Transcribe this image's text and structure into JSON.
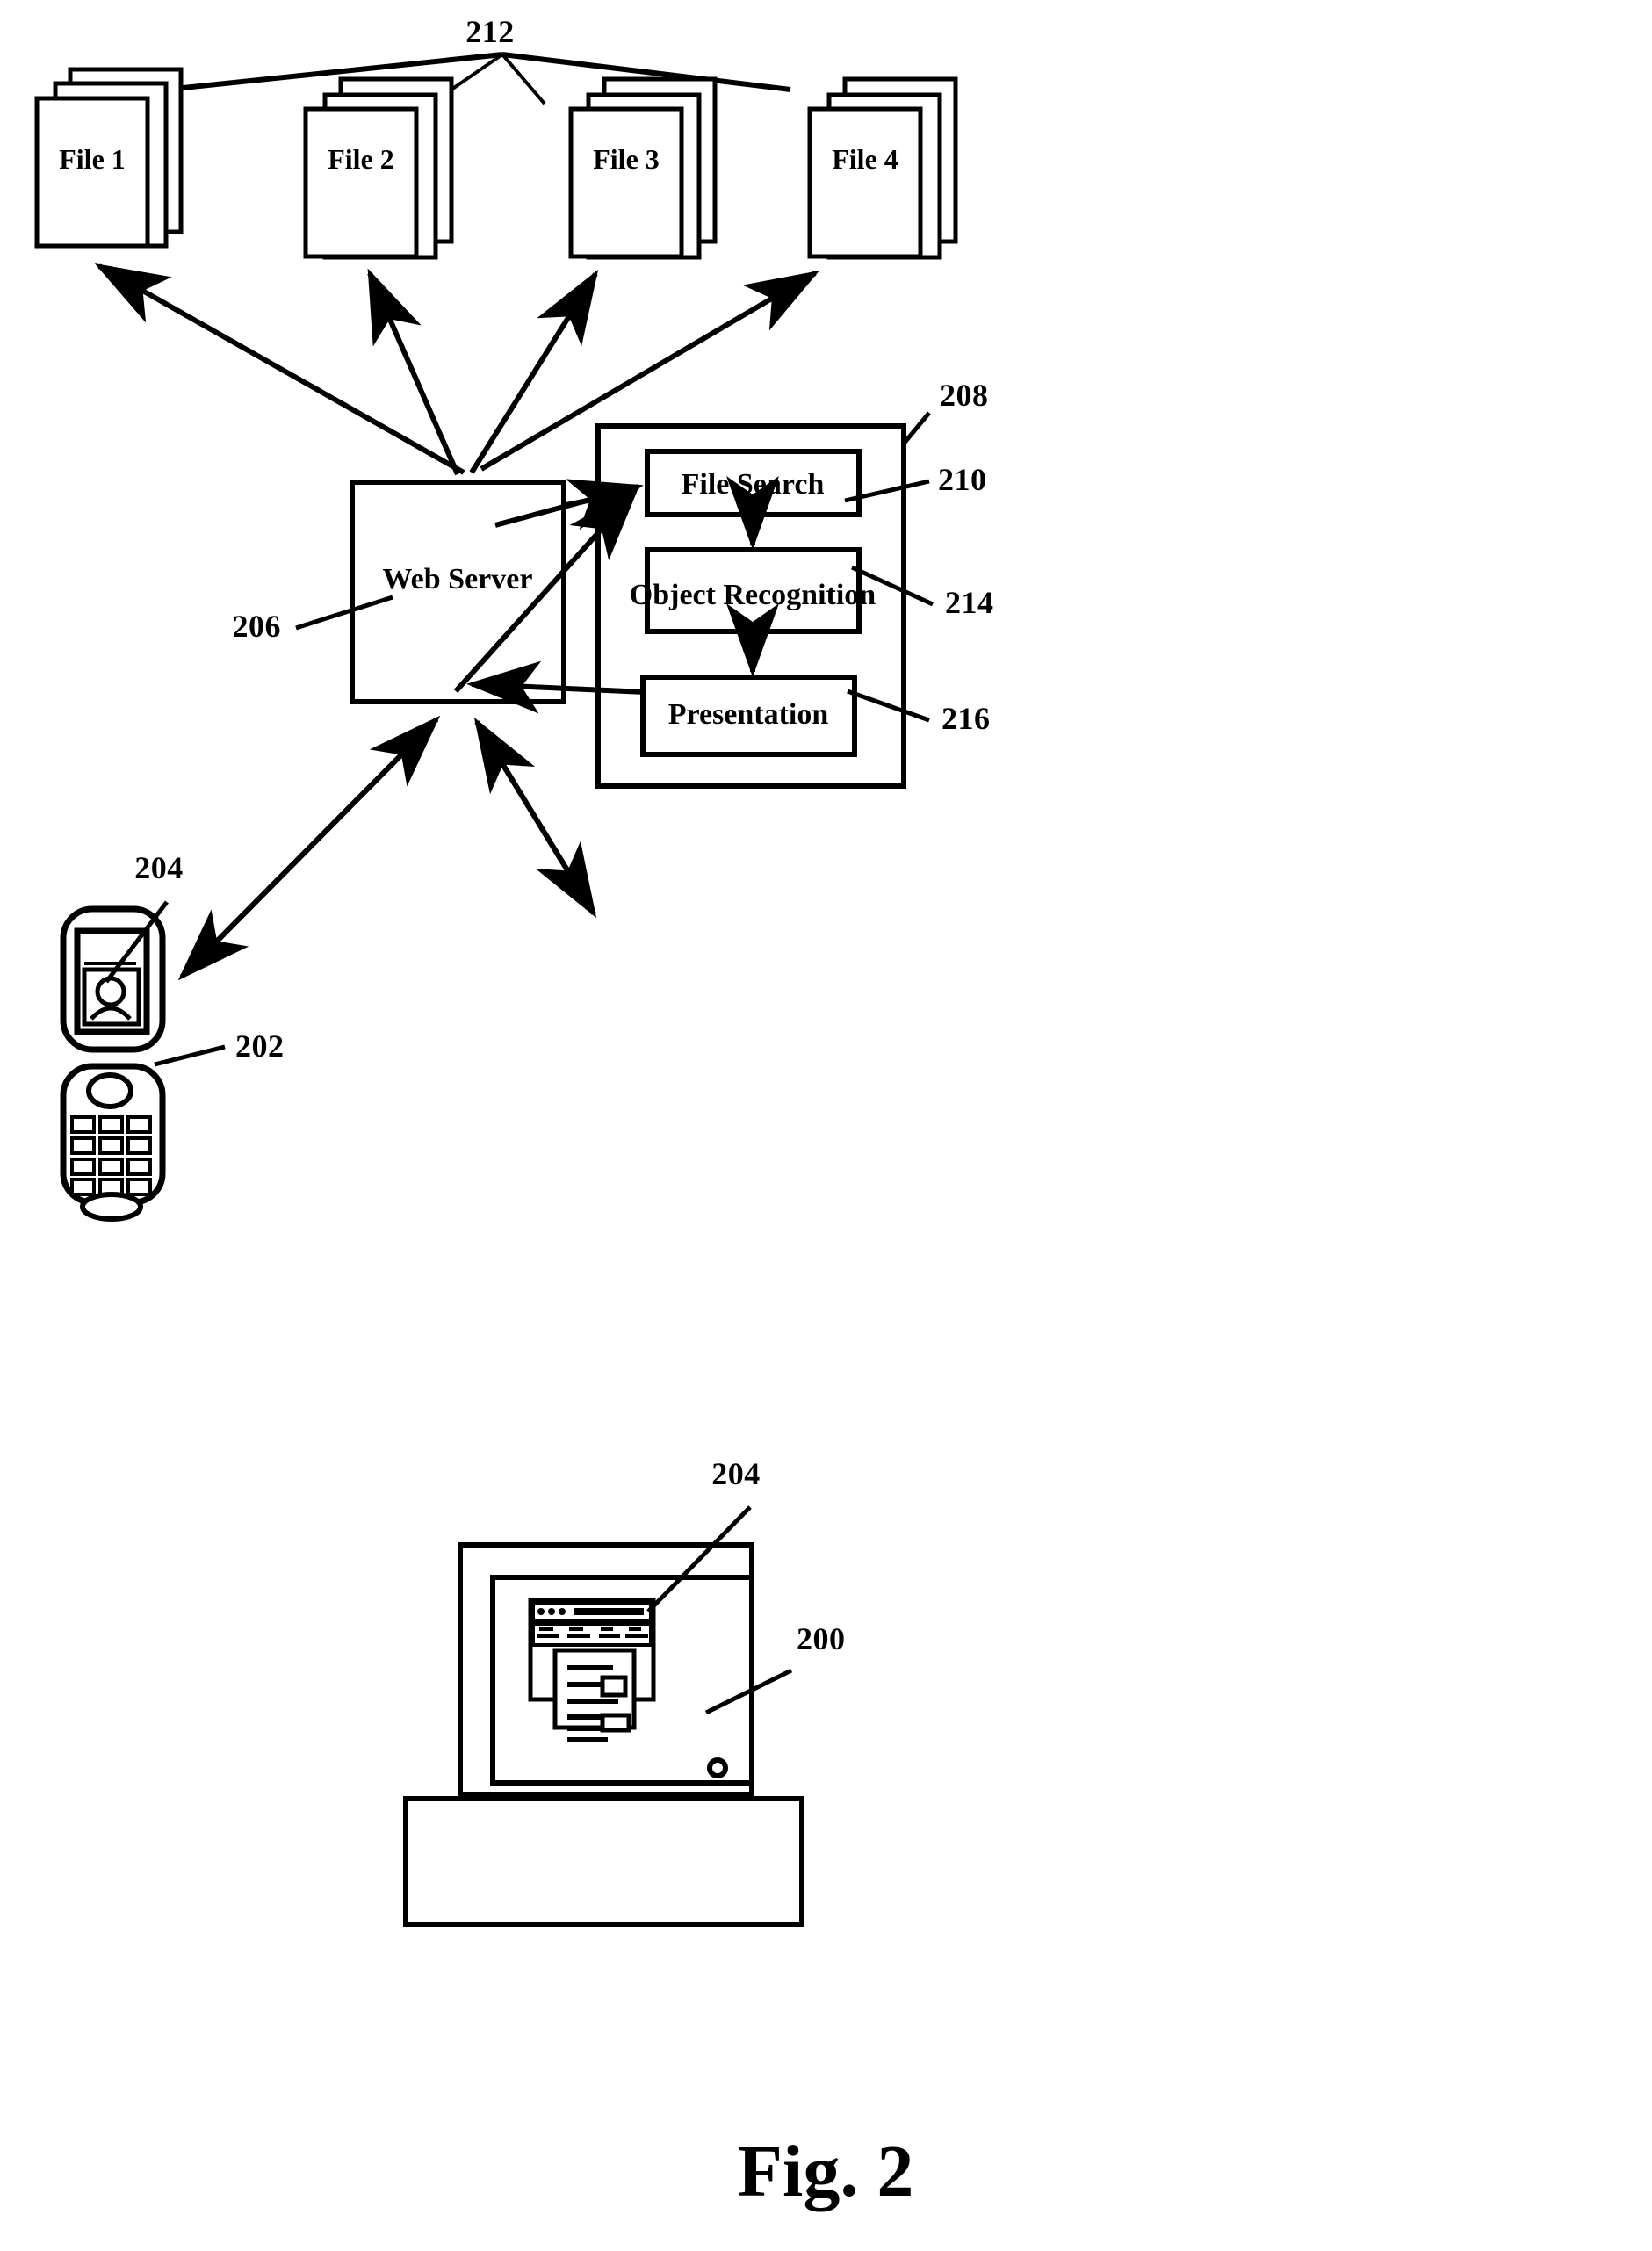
{
  "figure": {
    "caption": "Fig. 2",
    "files": [
      {
        "label": "File 1"
      },
      {
        "label": "File 2"
      },
      {
        "label": "File 3"
      },
      {
        "label": "File 4"
      }
    ],
    "server": {
      "label": "Web Server",
      "ref": "206"
    },
    "processing_container": {
      "ref": "208",
      "modules": [
        {
          "label": "File Search",
          "ref": "210"
        },
        {
          "label": "Object Recognition",
          "ref": "214"
        },
        {
          "label": "Presentation",
          "ref": "216"
        }
      ]
    },
    "reference_numerals": {
      "files_group": "212",
      "mobile_device": "202",
      "mobile_display": "204",
      "computer_display": "204",
      "computer": "200",
      "server": "206",
      "processing_container": "208",
      "file_search": "210",
      "object_recognition": "214",
      "presentation": "216"
    },
    "devices": {
      "mobile_phone": {
        "ref": "202",
        "screen_ref": "204",
        "icon": "person-avatar-icon",
        "keypad_rows": 4,
        "keypad_cols": 3
      },
      "desktop_computer": {
        "ref": "200",
        "screen_ref": "204",
        "icon": "browser-window-icon"
      }
    },
    "colors": {
      "ink": "#000000",
      "paper": "#ffffff"
    }
  }
}
